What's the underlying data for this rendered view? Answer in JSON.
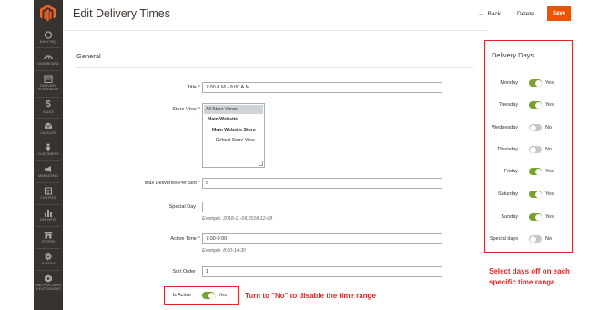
{
  "brand": {
    "accent": "#eb5202",
    "sidebar_bg": "#373330",
    "toggle_on": "#79a22e",
    "annotation": "#e22626"
  },
  "sidebar": {
    "logo_icon": "magento-logo-icon",
    "items": [
      {
        "label": "EASY FAQ",
        "icon": "circle-icon"
      },
      {
        "label": "DASHBOARD",
        "icon": "speedometer-icon"
      },
      {
        "label": "DELIVERY SCHEDULES",
        "icon": "calendar-icon"
      },
      {
        "label": "SALES",
        "icon": "dollar-icon"
      },
      {
        "label": "CATALOG",
        "icon": "cube-icon"
      },
      {
        "label": "CUSTOMERS",
        "icon": "person-icon"
      },
      {
        "label": "MARKETING",
        "icon": "megaphone-icon"
      },
      {
        "label": "CONTENT",
        "icon": "layout-icon"
      },
      {
        "label": "REPORTS",
        "icon": "bar-chart-icon"
      },
      {
        "label": "STORES",
        "icon": "store-icon"
      },
      {
        "label": "SYSTEM",
        "icon": "gear-icon"
      },
      {
        "label": "FIND PARTNERS & EXTENSIONS",
        "icon": "partners-icon"
      }
    ]
  },
  "header": {
    "title": "Edit Delivery Times",
    "back": "Back",
    "back_icon": "arrow-left-icon",
    "delete": "Delete",
    "save": "Save"
  },
  "form": {
    "section_title": "General",
    "title": {
      "label": "Title",
      "value": "7:00 A.M - 9:00 A.M"
    },
    "store_view": {
      "label": "Store View",
      "options": [
        "All Store Views",
        "Main Website",
        "Main Website Store",
        "Default Store View"
      ]
    },
    "max_deliveries": {
      "label": "Max Deliveries Per Slot",
      "value": "5"
    },
    "special_day": {
      "label": "Special Day",
      "value": "",
      "note": "Example: 2018-11-09,2018-12-08"
    },
    "active_time": {
      "label": "Active Time",
      "value": "7:00-9:00",
      "note": "Example: 8:00-14:30"
    },
    "sort_order": {
      "label": "Sort Order",
      "value": "1"
    },
    "is_active": {
      "label": "Is Active",
      "value": "Yes",
      "enabled": true
    }
  },
  "delivery_days": {
    "title": "Delivery Days",
    "days": [
      {
        "label": "Monday",
        "value": "Yes",
        "on": true
      },
      {
        "label": "Tuesday",
        "value": "Yes",
        "on": true
      },
      {
        "label": "Wednesday",
        "value": "No",
        "on": false
      },
      {
        "label": "Thursday",
        "value": "No",
        "on": false
      },
      {
        "label": "Friday",
        "value": "Yes",
        "on": true
      },
      {
        "label": "Saturday",
        "value": "Yes",
        "on": true
      },
      {
        "label": "Sunday",
        "value": "Yes",
        "on": true
      },
      {
        "label": "Special days",
        "value": "No",
        "on": false
      }
    ]
  },
  "annotations": {
    "days_off": "Select days off on each specific time range",
    "disable": "Turn to \"No\" to disable the time range"
  }
}
